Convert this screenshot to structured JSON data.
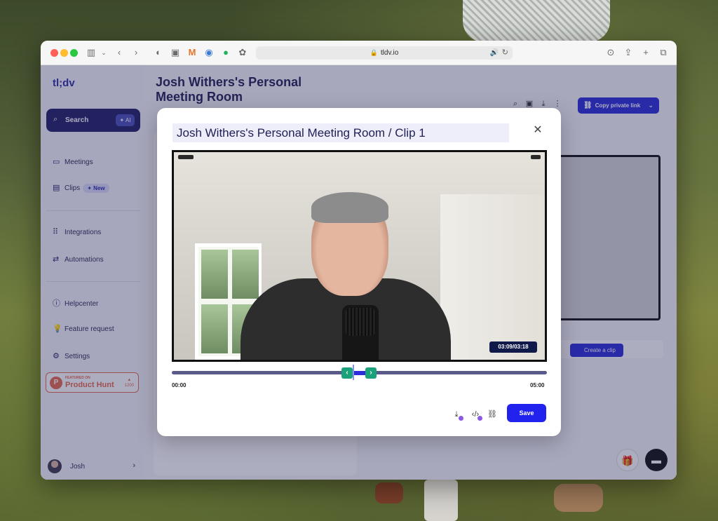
{
  "browser": {
    "url": "tldv.io"
  },
  "sidebar": {
    "logo": "tl;dv",
    "search": {
      "label": "Search",
      "ai_label": "AI"
    },
    "items": [
      {
        "label": "Meetings",
        "icon": "video-icon"
      },
      {
        "label": "Clips",
        "icon": "clips-icon",
        "badge": "New"
      },
      {
        "label": "Integrations",
        "icon": "grid-icon"
      },
      {
        "label": "Automations",
        "icon": "arrows-icon"
      },
      {
        "label": "Helpcenter",
        "icon": "info-icon"
      },
      {
        "label": "Feature request",
        "icon": "bulb-icon"
      },
      {
        "label": "Settings",
        "icon": "gear-icon"
      }
    ],
    "product_hunt": {
      "small": "FEATURED ON",
      "name": "Product Hunt",
      "count": "1200"
    },
    "user": {
      "name": "Josh"
    }
  },
  "main": {
    "title": "Josh Withers's Personal Meeting Room",
    "copy_link_label": "Copy private link",
    "create_clip_label": "Create a clip"
  },
  "modal": {
    "clip_title": "Josh Withers's Personal Meeting Room / Clip 1",
    "time_chip": "03:09/03:18",
    "time_start": "00:00",
    "time_end": "05:00",
    "save_label": "Save",
    "accent": "#2222ee",
    "handle_color": "#1aa37a"
  }
}
